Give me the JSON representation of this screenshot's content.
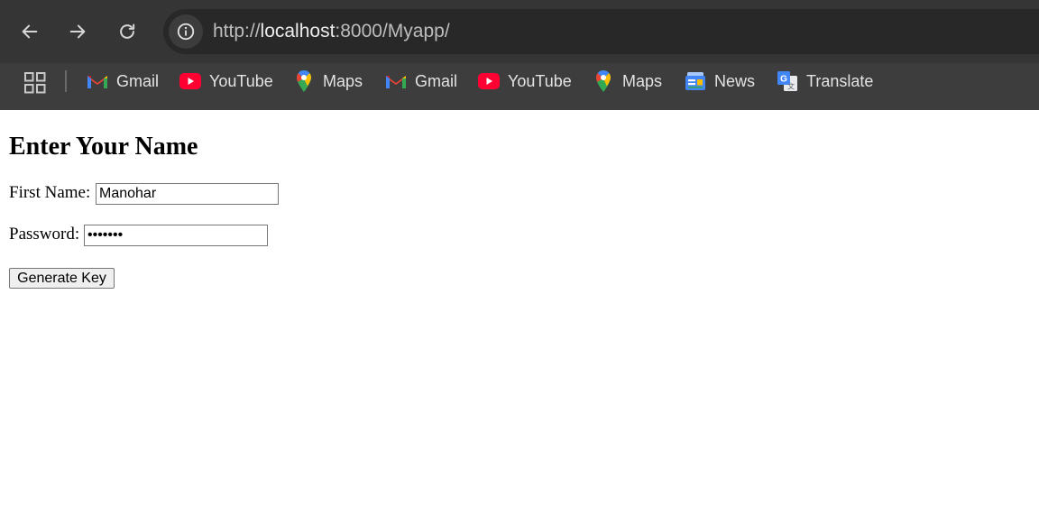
{
  "browser": {
    "url_scheme": "http://",
    "url_host": "localhost",
    "url_rest": ":8000/Myapp/",
    "bookmarks": [
      {
        "label": "Gmail",
        "icon": "gmail-icon"
      },
      {
        "label": "YouTube",
        "icon": "youtube-icon"
      },
      {
        "label": "Maps",
        "icon": "maps-icon"
      },
      {
        "label": "Gmail",
        "icon": "gmail-icon"
      },
      {
        "label": "YouTube",
        "icon": "youtube-icon"
      },
      {
        "label": "Maps",
        "icon": "maps-icon"
      },
      {
        "label": "News",
        "icon": "news-icon"
      },
      {
        "label": "Translate",
        "icon": "translate-icon"
      }
    ],
    "colors": {
      "toolbar": "#353535",
      "bookmarks_bar": "#3d3d3d",
      "omnibox": "#282828"
    }
  },
  "form": {
    "title": "Enter Your Name",
    "first_name_label": "First Name:",
    "first_name_value": "Manohar",
    "password_label": "Password:",
    "password_masked": "•••••••",
    "submit_label": "Generate Key"
  }
}
